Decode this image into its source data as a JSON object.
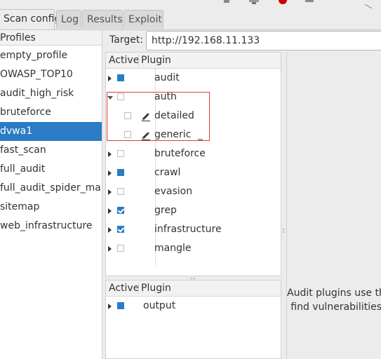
{
  "toolbar": {
    "icons": [
      "toolbar-icon",
      "toolbar-icon",
      "stop-icon",
      "toolbar-icon"
    ],
    "stop_color": "#cc0000"
  },
  "tabs": [
    {
      "label": "Scan config",
      "active": true
    },
    {
      "label": "Log",
      "active": false
    },
    {
      "label": "Results",
      "active": false
    },
    {
      "label": "Exploit",
      "active": false
    }
  ],
  "profiles": {
    "header": "Profiles",
    "items": [
      {
        "label": "empty_profile",
        "selected": false
      },
      {
        "label": "OWASP_TOP10",
        "selected": false
      },
      {
        "label": "audit_high_risk",
        "selected": false
      },
      {
        "label": "bruteforce",
        "selected": false
      },
      {
        "label": "dvwa1",
        "selected": true
      },
      {
        "label": "fast_scan",
        "selected": false
      },
      {
        "label": "full_audit",
        "selected": false
      },
      {
        "label": "full_audit_spider_man",
        "selected": false
      },
      {
        "label": "sitemap",
        "selected": false
      },
      {
        "label": "web_infrastructure",
        "selected": false
      }
    ]
  },
  "target": {
    "label": "Target:",
    "value": "http://192.168.11.133"
  },
  "plugins_tree": {
    "col_active": "Active",
    "col_plugin": "Plugin",
    "rows": [
      {
        "label": "audit",
        "state": "full",
        "expander": "collapsed",
        "level": 0
      },
      {
        "label": "auth",
        "state": "empty",
        "expander": "expanded",
        "level": 0
      },
      {
        "label": "detailed",
        "state": "empty",
        "expander": "none",
        "level": 1,
        "icon": "edit-icon"
      },
      {
        "label": "generic",
        "state": "empty",
        "expander": "none",
        "level": 1,
        "icon": "edit-icon",
        "suffix": "_"
      },
      {
        "label": "bruteforce",
        "state": "empty",
        "expander": "collapsed",
        "level": 0
      },
      {
        "label": "crawl",
        "state": "full",
        "expander": "collapsed",
        "level": 0
      },
      {
        "label": "evasion",
        "state": "empty",
        "expander": "collapsed",
        "level": 0
      },
      {
        "label": "grep",
        "state": "checked",
        "expander": "collapsed",
        "level": 0
      },
      {
        "label": "infrastructure",
        "state": "checked",
        "expander": "collapsed",
        "level": 0
      },
      {
        "label": "mangle",
        "state": "empty",
        "expander": "collapsed",
        "level": 0
      }
    ]
  },
  "output_tree": {
    "col_active": "Active",
    "col_plugin": "Plugin",
    "rows": [
      {
        "label": "output",
        "state": "full",
        "expander": "collapsed",
        "level": 0
      }
    ]
  },
  "description": {
    "lines": [
      "Audit plugins use the",
      "find vulnerabilities"
    ]
  },
  "colors": {
    "selection": "#2a7cc4",
    "highlight_box": "#e33b3b"
  }
}
